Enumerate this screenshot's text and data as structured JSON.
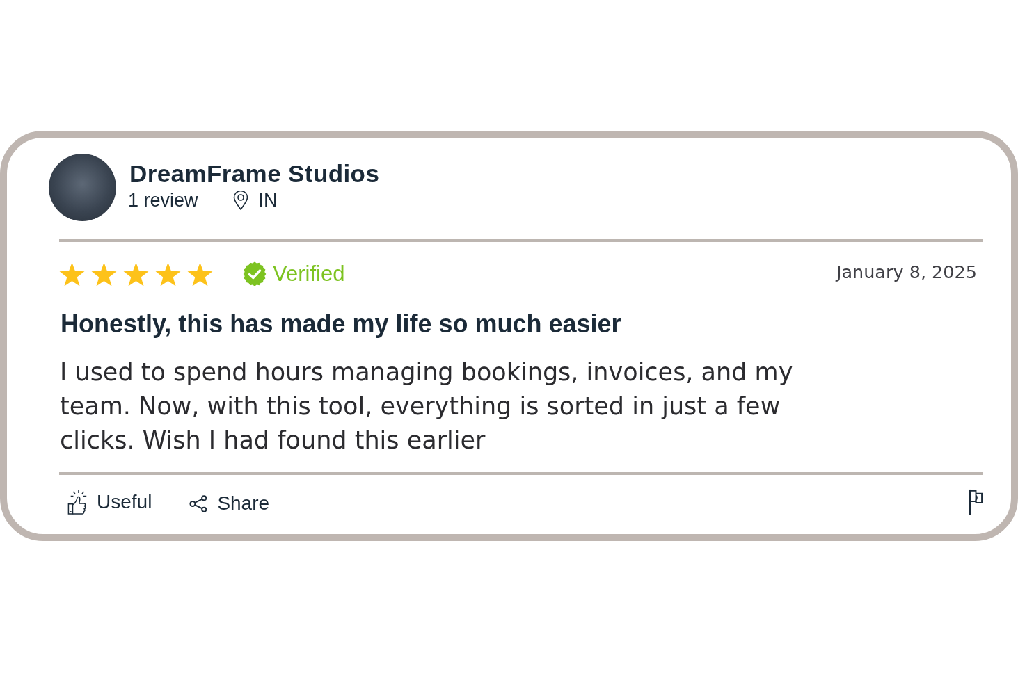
{
  "review": {
    "reviewer": {
      "name": "DreamFrame Studios",
      "review_count": "1 review",
      "location": "IN"
    },
    "stars": 5,
    "verified": true,
    "verified_label": "Verified",
    "date": "January 8, 2025",
    "title": "Honestly, this has made my life so much easier",
    "body": "I used to spend hours managing bookings, invoices, and my team. Now, with this tool, everything is sorted in just a few clicks. Wish I had found this earlier",
    "actions": [
      {
        "kind": "useful",
        "label": "Useful"
      },
      {
        "kind": "share",
        "label": "Share"
      }
    ]
  }
}
